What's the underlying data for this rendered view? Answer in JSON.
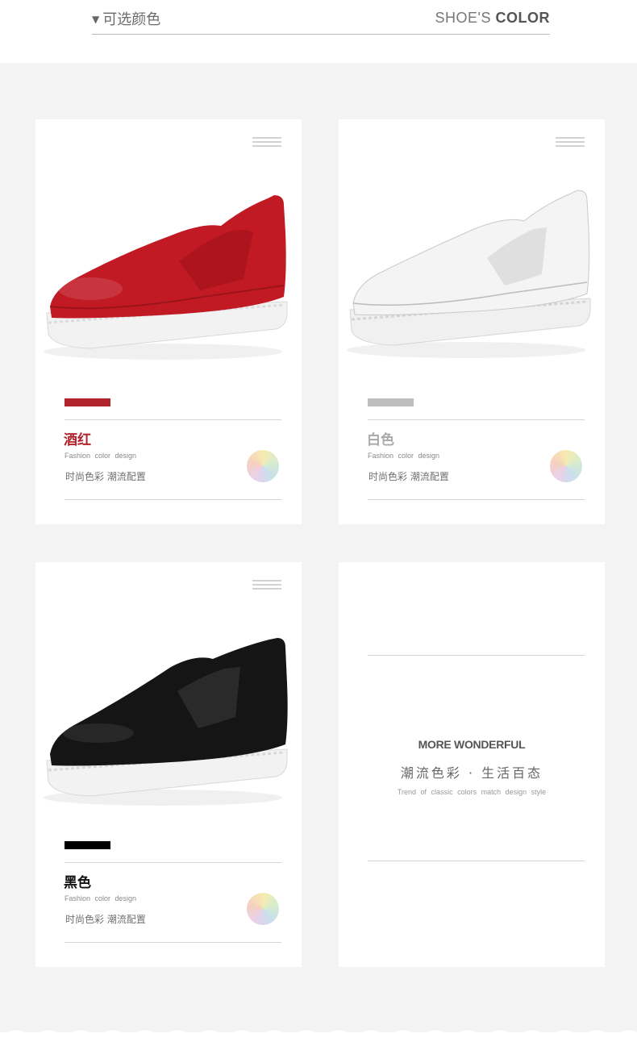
{
  "header": {
    "title_cn": "可选颜色",
    "title_en_light": "SHOE'S",
    "title_en_bold": "COLOR"
  },
  "cards": [
    {
      "name": "酒红",
      "subtitle": "Fashion color design",
      "desc": "时尚色彩  潮流配置",
      "swatch_color": "#b0232b",
      "name_color": "#b0232b",
      "shoe_color": "#c21a24"
    },
    {
      "name": "白色",
      "subtitle": "Fashion color design",
      "desc": "时尚色彩  潮流配置",
      "swatch_color": "#bdbdbd",
      "name_color": "#a9a9a9",
      "shoe_color": "#f4f4f4"
    },
    {
      "name": "黑色",
      "subtitle": "Fashion color design",
      "desc": "时尚色彩  潮流配置",
      "swatch_color": "#000000",
      "name_color": "#111111",
      "shoe_color": "#151515"
    }
  ],
  "wonderful": {
    "title": "MORE WONDERFUL",
    "subtitle": "潮流色彩 · 生活百态",
    "small": "Trend of classic colors match design style"
  }
}
